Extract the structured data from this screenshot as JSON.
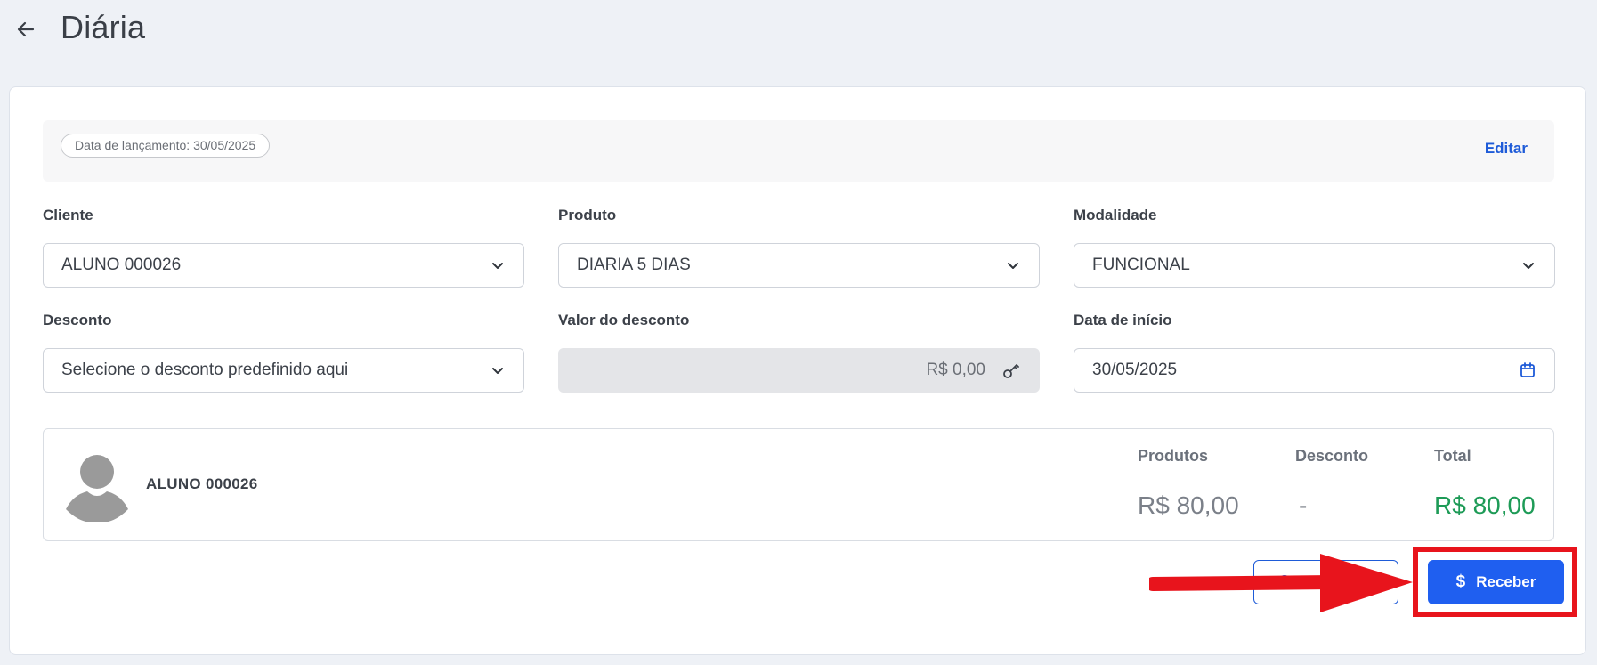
{
  "header": {
    "title": "Diária",
    "back_icon": "arrow-left-icon"
  },
  "info": {
    "launch_date": "Data de lançamento: 30/05/2025",
    "edit_label": "Editar"
  },
  "fields": {
    "cliente": {
      "label": "Cliente",
      "value": "ALUNO 000026"
    },
    "produto": {
      "label": "Produto",
      "value": "DIARIA 5 DIAS"
    },
    "modalidade": {
      "label": "Modalidade",
      "value": "FUNCIONAL"
    },
    "desconto": {
      "label": "Desconto",
      "placeholder": "Selecione o desconto predefinido aqui"
    },
    "valor_desconto": {
      "label": "Valor do desconto",
      "value": "R$ 0,00"
    },
    "data_inicio": {
      "label": "Data de início",
      "value": "30/05/2025"
    }
  },
  "summary": {
    "name": "ALUNO 000026",
    "produtos_label": "Produtos",
    "produtos_value": "R$ 80,00",
    "desconto_label": "Desconto",
    "desconto_value": "-",
    "total_label": "Total",
    "total_value": "R$ 80,00"
  },
  "actions": {
    "cancel_label": "Cancel",
    "receber_label": "Receber"
  },
  "colors": {
    "accent": "#1f5ff0",
    "total": "#1e9b57",
    "annotation": "#e8141c"
  }
}
